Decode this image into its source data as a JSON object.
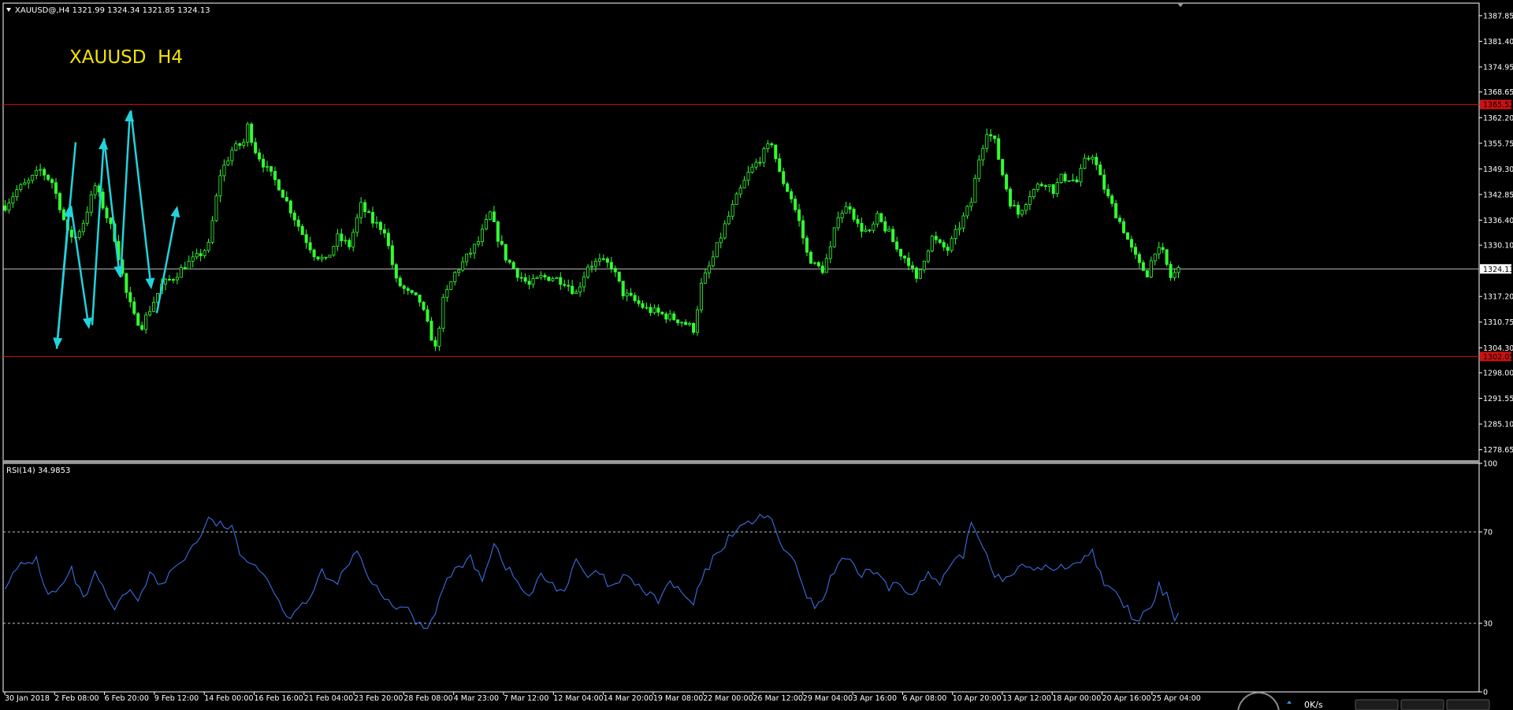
{
  "window": {
    "header_text": "XAUUSD@,H4  1321.99 1324.34 1321.85 1324.13",
    "watermark": "XAUUSD  H4",
    "rsi_label": "RSI(14) 34.9853",
    "net_speed": "0K/s"
  },
  "colors": {
    "background": "#000000",
    "candle": "#33ff33",
    "arrow": "#22d3dc",
    "level_line": "#cc1111",
    "current_price_line": "#c0c0c0",
    "rsi_line": "#3a6fe0",
    "watermark": "#f4e400",
    "axis_text": "#ffffff"
  },
  "chart_data": [
    {
      "type": "candlestick",
      "symbol": "XAUUSD",
      "timeframe": "H4",
      "ylim": [
        1276.0,
        1391.0
      ],
      "y_ticks": [
        "1387.85",
        "1381.40",
        "1374.95",
        "1368.65",
        "1362.20",
        "1355.75",
        "1349.30",
        "1342.85",
        "1336.40",
        "1330.10",
        "1317.20",
        "1310.75",
        "1304.30",
        "1298.00",
        "1291.55",
        "1285.10",
        "1278.65"
      ],
      "current_price": "1324.13",
      "resistance": {
        "value": 1365.5,
        "label": "1365.52"
      },
      "support": {
        "value": 1302.1,
        "label": "1302.05"
      },
      "x_labels": [
        "30 Jan 2018",
        "2 Feb 08:00",
        "6 Feb 20:00",
        "9 Feb 12:00",
        "14 Feb 00:00",
        "16 Feb 16:00",
        "21 Feb 04:00",
        "23 Feb 20:00",
        "28 Feb 08:00",
        "4 Mar 23:00",
        "7 Mar 12:00",
        "12 Mar 04:00",
        "14 Mar 20:00",
        "19 Mar 08:00",
        "22 Mar 00:00",
        "26 Mar 12:00",
        "29 Mar 04:00",
        "3 Apr 16:00",
        "6 Apr 08:00",
        "10 Apr 20:00",
        "13 Apr 12:00",
        "18 Apr 00:00",
        "20 Apr 16:00",
        "25 Apr 04:00"
      ],
      "close_anchors": [
        [
          0,
          1340
        ],
        [
          3,
          1344
        ],
        [
          6,
          1346
        ],
        [
          9,
          1349
        ],
        [
          12,
          1346
        ],
        [
          14,
          1340
        ],
        [
          16,
          1333
        ],
        [
          18,
          1332
        ],
        [
          20,
          1336
        ],
        [
          23,
          1345
        ],
        [
          25,
          1340
        ],
        [
          28,
          1332
        ],
        [
          31,
          1318
        ],
        [
          33,
          1312
        ],
        [
          35,
          1310
        ],
        [
          38,
          1316
        ],
        [
          40,
          1320
        ],
        [
          43,
          1322
        ],
        [
          46,
          1325
        ],
        [
          49,
          1327
        ],
        [
          52,
          1330
        ],
        [
          55,
          1348
        ],
        [
          58,
          1354
        ],
        [
          61,
          1356
        ],
        [
          62,
          1360
        ],
        [
          64,
          1354
        ],
        [
          67,
          1349
        ],
        [
          70,
          1345
        ],
        [
          73,
          1339
        ],
        [
          76,
          1333
        ],
        [
          79,
          1328
        ],
        [
          82,
          1326
        ],
        [
          85,
          1332
        ],
        [
          88,
          1330
        ],
        [
          91,
          1340
        ],
        [
          94,
          1336
        ],
        [
          97,
          1334
        ],
        [
          100,
          1321
        ],
        [
          103,
          1318
        ],
        [
          106,
          1316
        ],
        [
          108,
          1310
        ],
        [
          110,
          1304
        ],
        [
          112,
          1316
        ],
        [
          115,
          1323
        ],
        [
          118,
          1327
        ],
        [
          121,
          1331
        ],
        [
          124,
          1338
        ],
        [
          126,
          1332
        ],
        [
          128,
          1327
        ],
        [
          131,
          1323
        ],
        [
          134,
          1320
        ],
        [
          137,
          1322
        ],
        [
          140,
          1322
        ],
        [
          143,
          1321
        ],
        [
          146,
          1318
        ],
        [
          149,
          1325
        ],
        [
          152,
          1326
        ],
        [
          155,
          1325
        ],
        [
          158,
          1318
        ],
        [
          161,
          1316
        ],
        [
          164,
          1314
        ],
        [
          167,
          1313
        ],
        [
          170,
          1312
        ],
        [
          173,
          1311
        ],
        [
          176,
          1309
        ],
        [
          178,
          1320
        ],
        [
          181,
          1327
        ],
        [
          184,
          1335
        ],
        [
          187,
          1342
        ],
        [
          190,
          1348
        ],
        [
          193,
          1352
        ],
        [
          196,
          1356
        ],
        [
          198,
          1348
        ],
        [
          201,
          1342
        ],
        [
          203,
          1336
        ],
        [
          205,
          1328
        ],
        [
          207,
          1325
        ],
        [
          209,
          1324
        ],
        [
          211,
          1329
        ],
        [
          213,
          1338
        ],
        [
          216,
          1340
        ],
        [
          218,
          1335
        ],
        [
          221,
          1333
        ],
        [
          223,
          1337
        ],
        [
          226,
          1333
        ],
        [
          228,
          1329
        ],
        [
          231,
          1326
        ],
        [
          233,
          1321
        ],
        [
          235,
          1327
        ],
        [
          237,
          1332
        ],
        [
          239,
          1330
        ],
        [
          241,
          1329
        ],
        [
          243,
          1333
        ],
        [
          245,
          1337
        ],
        [
          247,
          1341
        ],
        [
          249,
          1352
        ],
        [
          251,
          1359
        ],
        [
          253,
          1356
        ],
        [
          255,
          1348
        ],
        [
          257,
          1341
        ],
        [
          259,
          1338
        ],
        [
          262,
          1343
        ],
        [
          264,
          1345
        ],
        [
          266,
          1346
        ],
        [
          268,
          1344
        ],
        [
          270,
          1347
        ],
        [
          272,
          1347
        ],
        [
          274,
          1346
        ],
        [
          276,
          1351
        ],
        [
          278,
          1353
        ],
        [
          280,
          1347
        ],
        [
          282,
          1342
        ],
        [
          284,
          1338
        ],
        [
          286,
          1334
        ],
        [
          288,
          1329
        ],
        [
          290,
          1325
        ],
        [
          292,
          1323
        ],
        [
          294,
          1329
        ],
        [
          296,
          1328
        ],
        [
          298,
          1322
        ],
        [
          300,
          1324
        ]
      ],
      "annotations": [
        {
          "type": "arrow",
          "from": [
            1316,
            1356
          ],
          "to": [
            1292,
            1304
          ]
        },
        {
          "type": "arrow",
          "from": [
            1292,
            1304
          ],
          "to": [
            1308,
            1340
          ]
        },
        {
          "type": "arrow",
          "from": [
            1310,
            1340
          ],
          "to": [
            1333,
            1309
          ]
        },
        {
          "type": "arrow",
          "from": [
            1337,
            1310
          ],
          "to": [
            1352,
            1357
          ]
        },
        {
          "type": "arrow",
          "from": [
            1352,
            1357
          ],
          "to": [
            1372,
            1322
          ]
        },
        {
          "type": "arrow",
          "from": [
            1373,
            1322
          ],
          "to": [
            1385,
            1364
          ]
        },
        {
          "type": "arrow",
          "from": [
            1386,
            1364
          ],
          "to": [
            1412,
            1319
          ]
        },
        {
          "type": "arrow",
          "from": [
            1419,
            1313
          ],
          "to": [
            1445,
            1340
          ]
        }
      ]
    },
    {
      "type": "line",
      "name": "RSI(14)",
      "last_value": 34.9853,
      "ylim": [
        0,
        100
      ],
      "y_ticks": [
        "100",
        "70",
        "30",
        "0"
      ],
      "levels": [
        70,
        30
      ],
      "anchors": [
        [
          0,
          47
        ],
        [
          4,
          55
        ],
        [
          8,
          58
        ],
        [
          11,
          42
        ],
        [
          14,
          45
        ],
        [
          17,
          53
        ],
        [
          20,
          40
        ],
        [
          23,
          51
        ],
        [
          26,
          42
        ],
        [
          28,
          35
        ],
        [
          31,
          44
        ],
        [
          34,
          41
        ],
        [
          37,
          52
        ],
        [
          40,
          46
        ],
        [
          43,
          54
        ],
        [
          46,
          59
        ],
        [
          49,
          66
        ],
        [
          52,
          75
        ],
        [
          55,
          73
        ],
        [
          58,
          72
        ],
        [
          60,
          59
        ],
        [
          63,
          58
        ],
        [
          66,
          52
        ],
        [
          69,
          44
        ],
        [
          72,
          32
        ],
        [
          75,
          38
        ],
        [
          78,
          41
        ],
        [
          81,
          52
        ],
        [
          84,
          47
        ],
        [
          87,
          53
        ],
        [
          90,
          62
        ],
        [
          93,
          48
        ],
        [
          96,
          44
        ],
        [
          99,
          36
        ],
        [
          102,
          38
        ],
        [
          105,
          31
        ],
        [
          108,
          28
        ],
        [
          110,
          36
        ],
        [
          113,
          49
        ],
        [
          116,
          55
        ],
        [
          119,
          58
        ],
        [
          122,
          50
        ],
        [
          125,
          65
        ],
        [
          128,
          55
        ],
        [
          131,
          48
        ],
        [
          134,
          41
        ],
        [
          137,
          51
        ],
        [
          140,
          47
        ],
        [
          143,
          44
        ],
        [
          146,
          57
        ],
        [
          149,
          50
        ],
        [
          152,
          52
        ],
        [
          155,
          45
        ],
        [
          158,
          50
        ],
        [
          161,
          48
        ],
        [
          164,
          43
        ],
        [
          167,
          40
        ],
        [
          170,
          48
        ],
        [
          173,
          43
        ],
        [
          176,
          38
        ],
        [
          178,
          49
        ],
        [
          181,
          58
        ],
        [
          184,
          65
        ],
        [
          187,
          72
        ],
        [
          190,
          73
        ],
        [
          193,
          78
        ],
        [
          196,
          74
        ],
        [
          198,
          66
        ],
        [
          201,
          58
        ],
        [
          203,
          52
        ],
        [
          205,
          40
        ],
        [
          207,
          38
        ],
        [
          209,
          40
        ],
        [
          211,
          50
        ],
        [
          213,
          56
        ],
        [
          216,
          58
        ],
        [
          218,
          50
        ],
        [
          221,
          54
        ],
        [
          223,
          52
        ],
        [
          226,
          45
        ],
        [
          228,
          48
        ],
        [
          231,
          43
        ],
        [
          233,
          46
        ],
        [
          236,
          51
        ],
        [
          239,
          47
        ],
        [
          242,
          55
        ],
        [
          245,
          60
        ],
        [
          247,
          74
        ],
        [
          249,
          68
        ],
        [
          251,
          60
        ],
        [
          253,
          52
        ],
        [
          255,
          49
        ],
        [
          257,
          52
        ],
        [
          259,
          55
        ],
        [
          262,
          53
        ],
        [
          265,
          55
        ],
        [
          268,
          53
        ],
        [
          271,
          55
        ],
        [
          274,
          57
        ],
        [
          276,
          59
        ],
        [
          278,
          61
        ],
        [
          280,
          52
        ],
        [
          282,
          45
        ],
        [
          284,
          42
        ],
        [
          287,
          36
        ],
        [
          289,
          30
        ],
        [
          291,
          34
        ],
        [
          293,
          36
        ],
        [
          295,
          46
        ],
        [
          297,
          42
        ],
        [
          299,
          33
        ],
        [
          300,
          35
        ]
      ]
    }
  ]
}
